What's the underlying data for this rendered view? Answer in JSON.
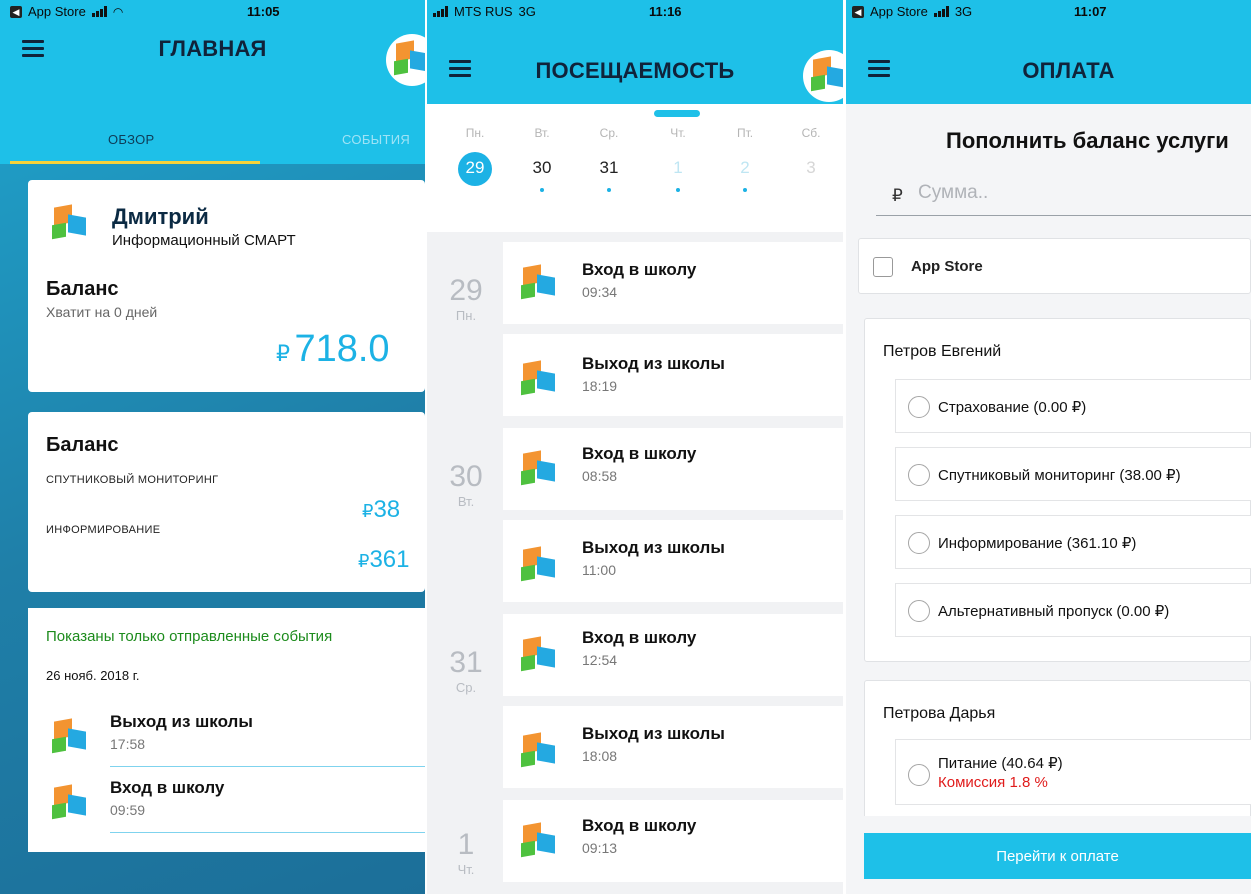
{
  "screen1": {
    "status": {
      "carrier": "App Store",
      "time": "11:05"
    },
    "title": "ГЛАВНАЯ",
    "tabs": [
      {
        "label": "ОБЗОР"
      },
      {
        "label": "СОБЫТИЯ"
      }
    ],
    "profile": {
      "name": "Дмитрий",
      "service": "Информационный СМАРТ"
    },
    "balance_main": {
      "label": "Баланс",
      "note": "Хватит на 0 дней",
      "currency": "₽",
      "amount": "718.0"
    },
    "balance_services": {
      "label": "Баланс",
      "items": [
        {
          "name": "СПУТНИКОВЫЙ МОНИТОРИНГ",
          "currency": "₽",
          "amount": "38"
        },
        {
          "name": "ИНФОРМИРОВАНИЕ",
          "currency": "₽",
          "amount": "361"
        }
      ]
    },
    "events": {
      "notice": "Показаны только отправленные события",
      "date": "26 нояб. 2018 г.",
      "items": [
        {
          "title": "Выход из школы",
          "time": "17:58"
        },
        {
          "title": "Вход в школу",
          "time": "09:59"
        }
      ]
    }
  },
  "screen2": {
    "status": {
      "carrier": "MTS RUS",
      "net": "3G",
      "time": "11:16"
    },
    "title": "ПОСЕЩАЕМОСТЬ",
    "week": [
      {
        "name": "Пн.",
        "num": "29"
      },
      {
        "name": "Вт.",
        "num": "30"
      },
      {
        "name": "Ср.",
        "num": "31"
      },
      {
        "name": "Чт.",
        "num": "1"
      },
      {
        "name": "Пт.",
        "num": "2"
      },
      {
        "name": "Сб.",
        "num": "3"
      }
    ],
    "groups": [
      {
        "num": "29",
        "day": "Пн."
      },
      {
        "num": "30",
        "day": "Вт."
      },
      {
        "num": "31",
        "day": "Ср."
      },
      {
        "num": "1",
        "day": "Чт."
      }
    ],
    "events": [
      {
        "title": "Вход в школу",
        "time": "09:34"
      },
      {
        "title": "Выход из школы",
        "time": "18:19"
      },
      {
        "title": "Вход в школу",
        "time": "08:58"
      },
      {
        "title": "Выход из школы",
        "time": "11:00"
      },
      {
        "title": "Вход в школу",
        "time": "12:54"
      },
      {
        "title": "Выход из школы",
        "time": "18:08"
      },
      {
        "title": "Вход в школу",
        "time": "09:13"
      }
    ]
  },
  "screen3": {
    "status": {
      "carrier": "App Store",
      "net": "3G",
      "time": "11:07"
    },
    "title": "ОПЛАТА",
    "heading": "Пополнить баланс услуги",
    "sum": {
      "currency": "₽",
      "placeholder": "Сумма.."
    },
    "method": "App Store",
    "people": [
      {
        "name": "Петров Евгений",
        "options": [
          "Страхование (0.00 ₽)",
          "Спутниковый мониторинг (38.00 ₽)",
          "Информирование (361.10 ₽)",
          "Альтернативный пропуск (0.00 ₽)"
        ]
      },
      {
        "name": "Петрова Дарья",
        "options": [
          "Питание (40.64 ₽)"
        ],
        "commission": "Комиссия 1.8 %"
      }
    ],
    "pay_button": "Перейти к оплате"
  }
}
